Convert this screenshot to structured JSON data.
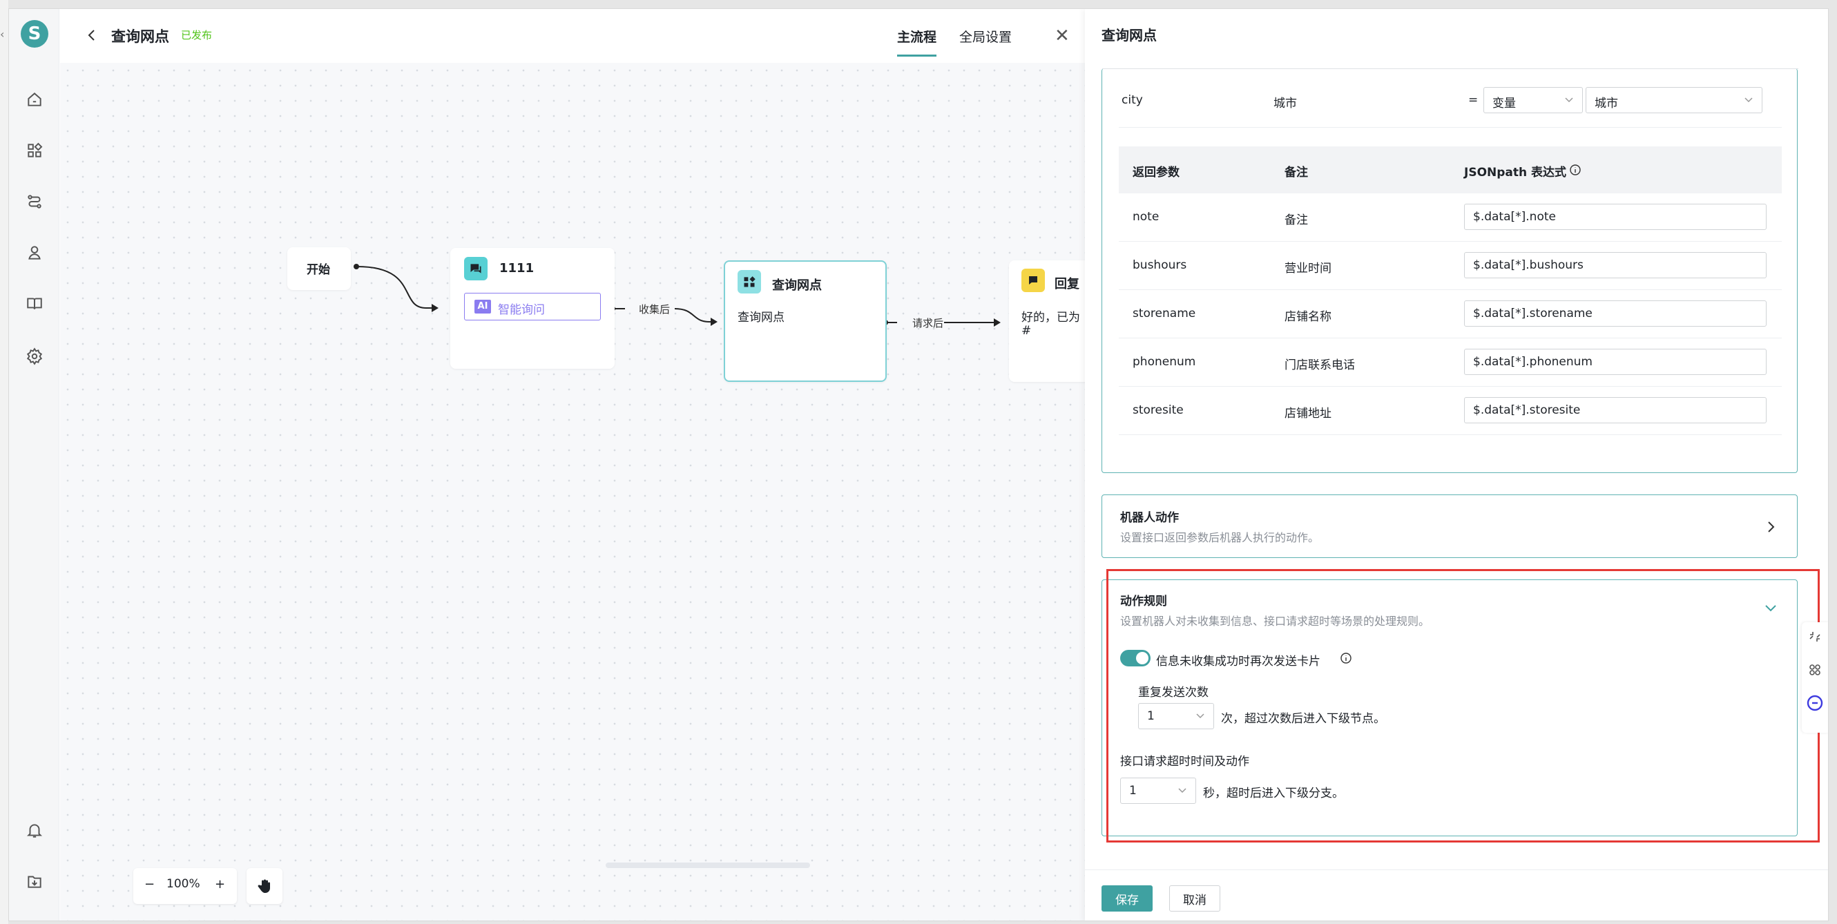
{
  "app": {
    "logo_letter": "S"
  },
  "header": {
    "title": "查询网点",
    "status": "已发布",
    "tabs": [
      {
        "label": "主流程"
      },
      {
        "label": "全局设置"
      }
    ],
    "close_symbol": "✕"
  },
  "canvas": {
    "nodes": {
      "start": {
        "label": "开始"
      },
      "collect": {
        "title": "1111",
        "tag_icon": "AI",
        "tag": "智能询问"
      },
      "query": {
        "title": "查询网点",
        "body": "查询网点"
      },
      "reply": {
        "title": "回复",
        "body_line1": "好的，已为",
        "body_line2": "#"
      }
    },
    "edges": {
      "after_collect": "收集后",
      "after_request": "请求后"
    },
    "zoom": {
      "minus": "−",
      "level": "100%",
      "plus": "+"
    }
  },
  "panel": {
    "title": "查询网点",
    "request_row": {
      "name": "city",
      "note": "城市",
      "eq": "=",
      "type_value": "变量",
      "var_value": "城市"
    },
    "return_params": {
      "headers": {
        "param": "返回参数",
        "note": "备注",
        "jsonpath": "JSONpath 表达式"
      },
      "rows": [
        {
          "param": "note",
          "note": "备注",
          "path": "$.data[*].note"
        },
        {
          "param": "bushours",
          "note": "营业时间",
          "path": "$.data[*].bushours"
        },
        {
          "param": "storename",
          "note": "店铺名称",
          "path": "$.data[*].storename"
        },
        {
          "param": "phonenum",
          "note": "门店联系电话",
          "path": "$.data[*].phonenum"
        },
        {
          "param": "storesite",
          "note": "店铺地址",
          "path": "$.data[*].storesite"
        }
      ]
    },
    "robot_action": {
      "title": "机器人动作",
      "desc": "设置接口返回参数后机器人执行的动作。"
    },
    "action_rules": {
      "title": "动作规则",
      "desc": "设置机器人对未收集到信息、接口请求超时等场景的处理规则。",
      "toggle_label": "信息未收集成功时再次发送卡片",
      "toggle_on": true,
      "repeat_label": "重复发送次数",
      "repeat_value": "1",
      "repeat_suffix": "次，超过次数后进入下级节点。",
      "timeout_label": "接口请求超时时间及动作",
      "timeout_value": "1",
      "timeout_suffix": "秒，超时后进入下级分支。"
    },
    "footer": {
      "save": "保存",
      "cancel": "取消"
    }
  },
  "colors": {
    "accent": "#3fa1a1",
    "status_green": "#52c41a",
    "highlight_red": "#e53935"
  }
}
